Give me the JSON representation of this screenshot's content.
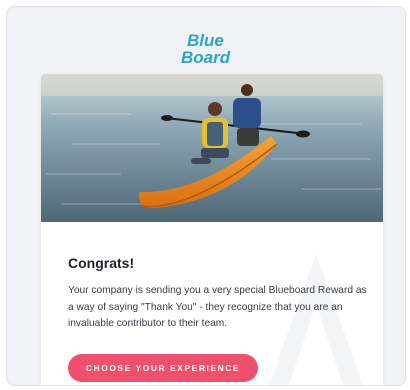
{
  "brand": {
    "logo_line1": "Blue",
    "logo_line2": "Board",
    "logo_color": "#2aa6c6"
  },
  "reward": {
    "heading": "Congrats!",
    "message": "Your company is sending you a very special Blueboard Reward as a way of saying \"Thank You\" - they recognize that you are an invaluable contributor to their team.",
    "cta_label": "CHOOSE YOUR EXPERIENCE",
    "cta_color": "#f0506e"
  },
  "hero_image": {
    "subject": "father and son kayaking on a lake at sunset",
    "kayak_color": "#f08a1c"
  }
}
